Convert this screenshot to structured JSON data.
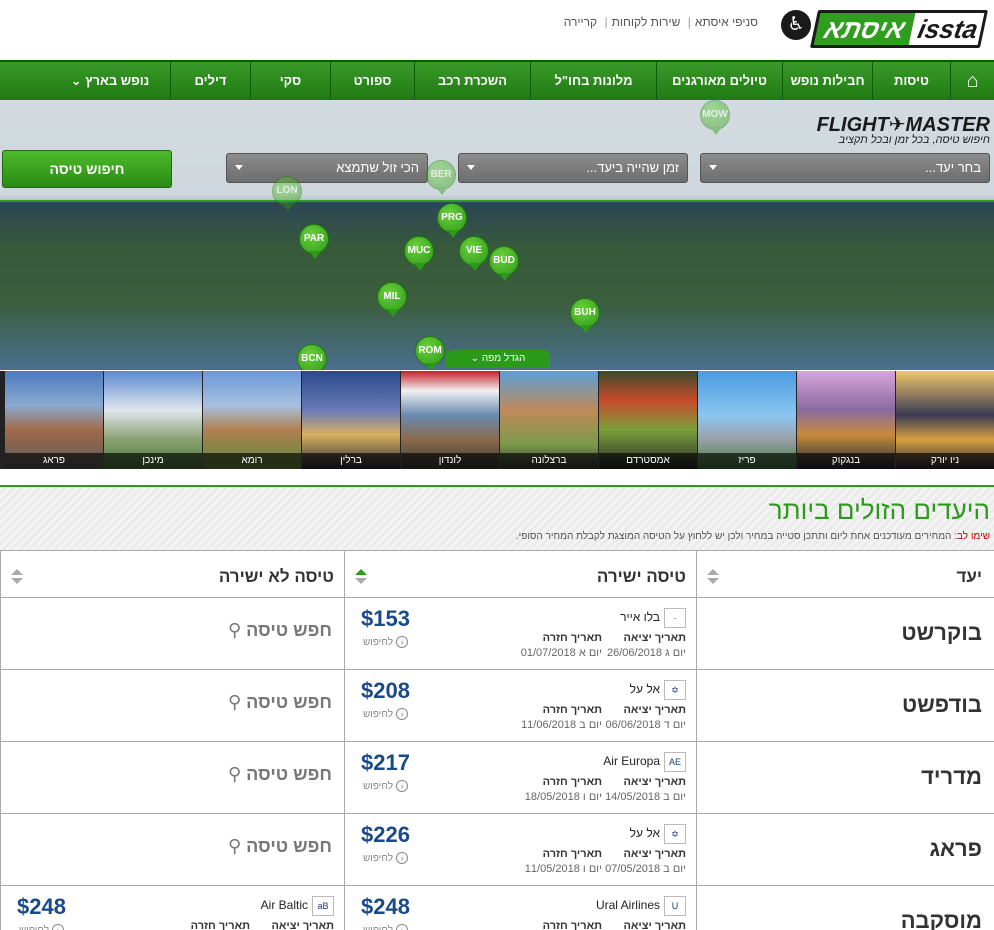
{
  "header": {
    "logo_latin": "issta",
    "logo_hebrew": "איסתא",
    "links": [
      "סניפי איסתא",
      "שירות לקוחות",
      "קריירה"
    ]
  },
  "nav": {
    "items": [
      "טיסות",
      "חבילות נופש",
      "טיולים מאורגנים",
      "מלונות בחו\"ל",
      "השכרת רכב",
      "ספורט",
      "סקי",
      "דילים",
      "נופש בארץ"
    ]
  },
  "search": {
    "brand": "FLIGHT✈MASTER",
    "tagline": "חיפוש טיסה, בכל זמן ובכל תקציב",
    "destination_placeholder": "בחר יעד...",
    "time_placeholder": "זמן שהייה ביעד...",
    "price_placeholder": "הכי זול שתמצא",
    "button": "חיפוש טיסה",
    "expand_map": "הגדל מפה"
  },
  "map_pins": [
    "MOW",
    "BER",
    "LON",
    "PRG",
    "PAR",
    "MUC",
    "VIE",
    "BUD",
    "MIL",
    "BUH",
    "ROM",
    "BCN"
  ],
  "destinations": [
    "ניו יורק",
    "בנגקוק",
    "פריז",
    "אמסטרדם",
    "ברצלונה",
    "לונדון",
    "ברלין",
    "רומא",
    "מינכן",
    "פראג"
  ],
  "cheapest": {
    "title": "היעדים הזולים ביותר",
    "note_label": "שימו לב:",
    "note_text": "המחירים מעודכנים אחת ליום ותתכן סטייה במחיר ולכן יש ללחוץ על הטיסה המוצגת לקבלת המחיר הסופי.",
    "columns": [
      "יעד",
      "טיסה ישירה",
      "טיסה לא ישירה"
    ],
    "labels": {
      "depart": "תאריך יציאה",
      "return": "תאריך חזרה",
      "more": "לחיפוש",
      "search": "חפש טיסה"
    },
    "rows": [
      {
        "dest": "בוקרשט",
        "airline": "בלו אייר",
        "logo": "·",
        "depart": "יום ג 26/06/2018",
        "return": "יום א 01/07/2018",
        "price": "$153"
      },
      {
        "dest": "בודפשט",
        "airline": "אל על",
        "logo": "✡",
        "depart": "יום ד 06/06/2018",
        "return": "יום ב 11/06/2018",
        "price": "$208"
      },
      {
        "dest": "מדריד",
        "airline": "Air Europa",
        "logo": "AE",
        "depart": "יום ב 14/05/2018",
        "return": "יום ו 18/05/2018",
        "price": "$217"
      },
      {
        "dest": "פראג",
        "airline": "אל על",
        "logo": "✡",
        "depart": "יום ב 07/05/2018",
        "return": "יום ו 11/05/2018",
        "price": "$226"
      },
      {
        "dest": "מוסקבה",
        "airline": "Ural Airlines",
        "logo": "U",
        "depart": "",
        "return": "",
        "price": "$248",
        "indirect": {
          "airline": "Air Baltic",
          "logo": "aB",
          "price": "$248"
        }
      }
    ]
  }
}
